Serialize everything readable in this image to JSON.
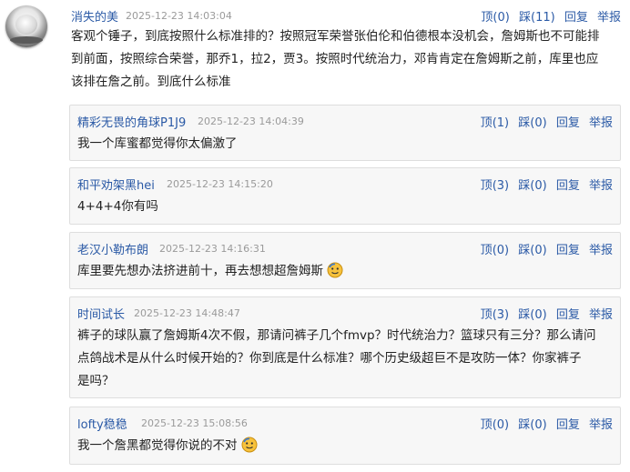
{
  "actions": {
    "up": "顶",
    "down": "踩",
    "reply": "回复",
    "report": "举报"
  },
  "main_comment": {
    "user": "消失的美",
    "time": "2025-12-23 14:03:04",
    "up_count": "(0)",
    "down_count": "(11)",
    "lines": [
      "客观个锤子，到底按照什么标准排的？按照冠军荣誉张伯伦和伯德根本没机会，詹姆斯也不可能排",
      "到前面，按照综合荣誉，那乔1，拉2，贾3。按照时代统治力，邓肯肯定在詹姆斯之前，库里也应",
      "该排在詹之前。到底什么标准"
    ]
  },
  "replies": [
    {
      "user": "精彩无畏的角球P1J9",
      "time": "2025-12-23 14:04:39",
      "up_count": "(1)",
      "down_count": "(0)",
      "lines": [
        "我一个库蜜都觉得你太偏激了"
      ],
      "emoji": false
    },
    {
      "user": "和平劝架黑hei",
      "time": "2025-12-23 14:15:20",
      "up_count": "(3)",
      "down_count": "(0)",
      "lines": [
        "4+4+4你有吗"
      ],
      "emoji": false
    },
    {
      "user": "老汉小勒布朗",
      "time": "2025-12-23 14:16:31",
      "up_count": "(0)",
      "down_count": "(0)",
      "lines": [
        "库里要先想办法挤进前十，再去想想超詹姆斯"
      ],
      "emoji": true
    },
    {
      "user": "时间试长",
      "time": "2025-12-23 14:48:47",
      "up_count": "(3)",
      "down_count": "(0)",
      "lines": [
        "裤子的球队赢了詹姆斯4次不假，那请问裤子几个fmvp？时代统治力？篮球只有三分？那么请问",
        "点鸽战术是从什么时候开始的？你到底是什么标准？哪个历史级超巨不是攻防一体？你家裤子",
        "是吗？"
      ],
      "emoji": false
    },
    {
      "user": "lofty稳稳",
      "time": "2025-12-23 15:08:56",
      "up_count": "(0)",
      "down_count": "(0)",
      "lines": [
        "我一个詹黑都觉得你说的不对"
      ],
      "emoji": true
    }
  ]
}
